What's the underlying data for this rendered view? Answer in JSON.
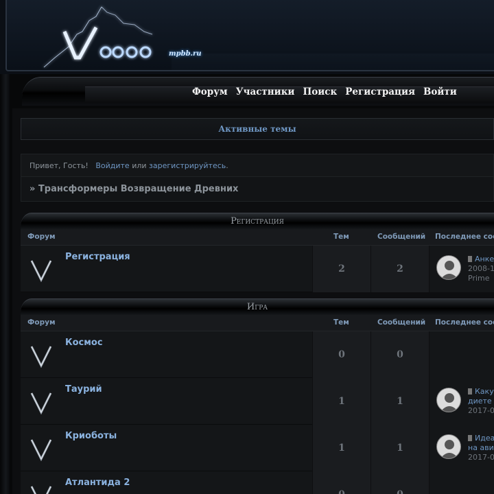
{
  "header": {
    "logo_text": "Voodoo",
    "logo_sub": "mpbb.ru"
  },
  "nav": {
    "items": [
      "Форум",
      "Участники",
      "Поиск",
      "Регистрация",
      "Войти"
    ]
  },
  "active_topics": {
    "label": "Активные темы"
  },
  "greeting": {
    "text": "Привет, Гость!",
    "login_link": "Войдите",
    "or": "или",
    "register_link": "зарегистрируйтесь",
    "end": "."
  },
  "breadcrumb": {
    "text": "» Трансформеры Возвращение Древних"
  },
  "columns": {
    "forum": "Форум",
    "topics": "Тем",
    "posts": "Сообщений",
    "last": "Последнее соо"
  },
  "categories": [
    {
      "title": "Регистрация",
      "forums": [
        {
          "title": "Регистрация",
          "topics": "2",
          "posts": "2",
          "last_line1": "Анке",
          "last_line2": "2008-1",
          "last_line3": "Prime"
        }
      ]
    },
    {
      "title": "Игра",
      "forums": [
        {
          "title": "Космос",
          "topics": "0",
          "posts": "0"
        },
        {
          "title": "Таурий",
          "topics": "1",
          "posts": "1",
          "last_line1": "Каку",
          "last_line2": "диете",
          "last_line3": "2017-0"
        },
        {
          "title": "Криоботы",
          "topics": "1",
          "posts": "1",
          "last_line1": "Идеа",
          "last_line2": "на авит",
          "last_line3": "2017-0"
        },
        {
          "title": "Атлантида 2",
          "topics": "0",
          "posts": "0"
        }
      ]
    }
  ]
}
